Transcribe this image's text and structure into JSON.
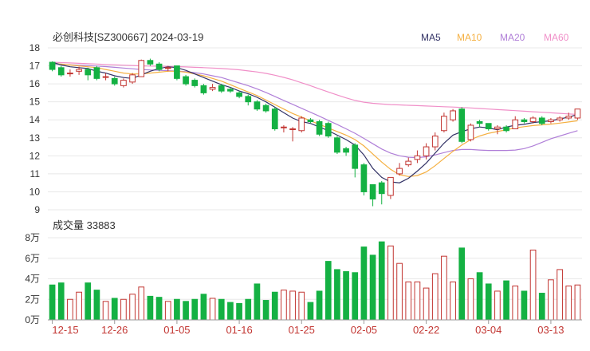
{
  "chart_data": {
    "type": "candlestick",
    "title": "必创科技[SZ300667] 2024-03-19",
    "volume_label": "成交量 33883",
    "colors": {
      "up": "#c23531",
      "down": "#14b143",
      "MA5": "#333366",
      "MA10": "#f5b041",
      "MA20": "#b07fd8",
      "MA60": "#f08fc8"
    },
    "legend": [
      {
        "name": "MA5",
        "color": "#333366"
      },
      {
        "name": "MA10",
        "color": "#f5b041"
      },
      {
        "name": "MA20",
        "color": "#b07fd8"
      },
      {
        "name": "MA60",
        "color": "#f08fc8"
      }
    ],
    "price_axis": {
      "min": 9,
      "max": 18,
      "ticks": [
        "9",
        "10",
        "11",
        "12",
        "13",
        "14",
        "15",
        "16",
        "17",
        "18"
      ]
    },
    "volume_axis": {
      "min": 0,
      "max": 8,
      "ticks": [
        "0万",
        "2万",
        "4万",
        "6万",
        "8万"
      ],
      "tick_values": [
        0,
        2,
        4,
        6,
        8
      ]
    },
    "x_ticks": [
      {
        "label": "12-15",
        "index": 0
      },
      {
        "label": "12-26",
        "index": 7
      },
      {
        "label": "01-05",
        "index": 14
      },
      {
        "label": "01-16",
        "index": 21
      },
      {
        "label": "01-25",
        "index": 28
      },
      {
        "label": "02-05",
        "index": 35
      },
      {
        "label": "02-22",
        "index": 42
      },
      {
        "label": "03-04",
        "index": 49
      },
      {
        "label": "03-13",
        "index": 56
      }
    ],
    "ohlc": [
      [
        17.2,
        16.8,
        17.25,
        16.7
      ],
      [
        16.9,
        16.5,
        17.0,
        16.4
      ],
      [
        16.6,
        16.6,
        16.8,
        16.4
      ],
      [
        16.7,
        16.8,
        16.95,
        16.5
      ],
      [
        16.8,
        16.5,
        16.9,
        16.2
      ],
      [
        16.9,
        16.3,
        17.0,
        16.2
      ],
      [
        16.4,
        16.4,
        16.6,
        16.2
      ],
      [
        16.3,
        16.0,
        16.4,
        15.9
      ],
      [
        15.9,
        16.2,
        16.3,
        15.8
      ],
      [
        16.1,
        16.5,
        16.6,
        16.0
      ],
      [
        16.4,
        17.3,
        17.35,
        16.4
      ],
      [
        17.3,
        17.1,
        17.4,
        17.0
      ],
      [
        17.1,
        16.8,
        17.2,
        16.7
      ],
      [
        16.9,
        16.9,
        17.0,
        16.7
      ],
      [
        17.0,
        16.3,
        17.0,
        16.2
      ],
      [
        16.4,
        16.0,
        16.5,
        15.9
      ],
      [
        16.2,
        15.9,
        16.3,
        15.8
      ],
      [
        15.9,
        15.5,
        16.0,
        15.4
      ],
      [
        15.7,
        15.8,
        16.0,
        15.6
      ],
      [
        15.9,
        15.6,
        16.0,
        15.5
      ],
      [
        15.7,
        15.6,
        15.8,
        15.5
      ],
      [
        15.5,
        15.3,
        15.6,
        15.2
      ],
      [
        15.3,
        15.0,
        15.4,
        14.8
      ],
      [
        15.0,
        14.6,
        15.1,
        14.5
      ],
      [
        14.8,
        14.5,
        14.9,
        14.4
      ],
      [
        14.6,
        13.5,
        14.7,
        13.4
      ],
      [
        13.6,
        13.6,
        13.7,
        13.3
      ],
      [
        13.5,
        13.5,
        13.6,
        12.8
      ],
      [
        13.4,
        14.1,
        14.2,
        13.3
      ],
      [
        14.0,
        13.9,
        14.1,
        13.8
      ],
      [
        13.9,
        13.2,
        14.0,
        13.1
      ],
      [
        13.8,
        13.1,
        13.9,
        13.0
      ],
      [
        13.0,
        12.2,
        13.1,
        12.1
      ],
      [
        12.4,
        12.2,
        12.5,
        12.0
      ],
      [
        12.6,
        11.3,
        12.7,
        10.8
      ],
      [
        11.5,
        10.0,
        11.6,
        9.8
      ],
      [
        10.4,
        9.6,
        10.4,
        9.2
      ],
      [
        10.5,
        9.9,
        10.6,
        9.3
      ],
      [
        9.8,
        10.8,
        10.8,
        9.6
      ],
      [
        11.0,
        11.3,
        11.6,
        10.9
      ],
      [
        11.5,
        11.7,
        11.9,
        11.4
      ],
      [
        11.8,
        12.0,
        12.3,
        11.6
      ],
      [
        12.0,
        12.5,
        12.7,
        11.8
      ],
      [
        12.5,
        13.1,
        13.3,
        12.3
      ],
      [
        13.4,
        14.2,
        14.4,
        13.3
      ],
      [
        14.0,
        14.5,
        14.6,
        13.9
      ],
      [
        14.6,
        12.8,
        14.7,
        12.7
      ],
      [
        12.9,
        13.7,
        13.8,
        12.8
      ],
      [
        13.9,
        13.8,
        14.0,
        13.6
      ],
      [
        13.8,
        13.5,
        13.8,
        13.4
      ],
      [
        13.5,
        13.6,
        13.7,
        13.2
      ],
      [
        13.6,
        13.4,
        13.7,
        13.3
      ],
      [
        13.5,
        14.0,
        14.2,
        13.5
      ],
      [
        14.0,
        13.9,
        14.1,
        13.8
      ],
      [
        13.9,
        14.1,
        14.2,
        13.8
      ],
      [
        14.1,
        13.8,
        14.2,
        13.7
      ],
      [
        13.9,
        14.0,
        14.1,
        13.8
      ],
      [
        14.0,
        14.1,
        14.2,
        13.9
      ],
      [
        14.1,
        14.2,
        14.4,
        14.0
      ],
      [
        14.1,
        14.6,
        14.6,
        14.0
      ]
    ],
    "volume": [
      3.4,
      3.6,
      2.0,
      2.7,
      3.6,
      2.9,
      1.8,
      2.1,
      2.0,
      2.5,
      3.2,
      2.3,
      2.2,
      1.8,
      2.0,
      1.8,
      2.0,
      2.5,
      2.1,
      2.0,
      1.7,
      1.6,
      2.0,
      3.5,
      1.9,
      2.7,
      2.9,
      2.8,
      2.7,
      1.7,
      2.8,
      5.7,
      4.9,
      4.7,
      4.6,
      7.1,
      6.3,
      7.6,
      7.2,
      5.5,
      3.7,
      3.7,
      3.1,
      4.5,
      6.2,
      3.7,
      7.0,
      4.0,
      4.6,
      3.5,
      2.8,
      3.8,
      3.3,
      2.8,
      6.8,
      2.6,
      3.9,
      4.9,
      3.3,
      3.4
    ],
    "ma": {
      "MA5": [
        17.2,
        17.05,
        16.95,
        16.9,
        16.85,
        16.7,
        16.6,
        16.45,
        16.35,
        16.3,
        16.5,
        16.7,
        16.85,
        16.95,
        16.9,
        16.75,
        16.55,
        16.35,
        16.15,
        15.95,
        15.8,
        15.6,
        15.45,
        15.25,
        15.0,
        14.7,
        14.4,
        14.1,
        13.9,
        13.8,
        13.6,
        13.4,
        13.15,
        12.9,
        12.6,
        12.05,
        11.3,
        10.8,
        10.55,
        10.5,
        10.75,
        11.15,
        11.6,
        12.15,
        12.7,
        13.15,
        13.35,
        13.5,
        13.6,
        13.55,
        13.45,
        13.6,
        13.7,
        13.75,
        13.85,
        13.9,
        13.95,
        14.05,
        14.15,
        14.3
      ],
      "MA10": [
        17.15,
        17.1,
        17.05,
        17.0,
        16.95,
        16.9,
        16.8,
        16.7,
        16.6,
        16.55,
        16.55,
        16.6,
        16.65,
        16.7,
        16.7,
        16.65,
        16.55,
        16.45,
        16.3,
        16.15,
        15.95,
        15.75,
        15.55,
        15.35,
        15.1,
        14.85,
        14.6,
        14.35,
        14.15,
        13.95,
        13.75,
        13.55,
        13.35,
        13.15,
        12.9,
        12.55,
        12.1,
        11.65,
        11.25,
        10.95,
        10.85,
        10.9,
        11.1,
        11.45,
        11.85,
        12.25,
        12.6,
        12.9,
        13.1,
        13.25,
        13.35,
        13.45,
        13.55,
        13.62,
        13.68,
        13.72,
        13.76,
        13.82,
        13.88,
        13.95
      ],
      "MA20": [
        17.1,
        17.08,
        17.06,
        17.04,
        17.02,
        16.99,
        16.96,
        16.92,
        16.88,
        16.84,
        16.8,
        16.77,
        16.75,
        16.73,
        16.71,
        16.68,
        16.62,
        16.55,
        16.45,
        16.35,
        16.2,
        16.05,
        15.9,
        15.72,
        15.52,
        15.3,
        15.08,
        14.86,
        14.64,
        14.42,
        14.2,
        13.97,
        13.74,
        13.5,
        13.25,
        12.97,
        12.67,
        12.38,
        12.15,
        12.0,
        11.92,
        11.9,
        11.95,
        12.05,
        12.18,
        12.3,
        12.35,
        12.35,
        12.32,
        12.3,
        12.3,
        12.3,
        12.32,
        12.4,
        12.55,
        12.75,
        12.95,
        13.1,
        13.25,
        13.4
      ],
      "MA60": [
        17.2,
        17.18,
        17.16,
        17.14,
        17.12,
        17.1,
        17.08,
        17.06,
        17.04,
        17.02,
        17.0,
        16.99,
        16.98,
        16.97,
        16.96,
        16.94,
        16.92,
        16.9,
        16.88,
        16.85,
        16.82,
        16.78,
        16.72,
        16.66,
        16.58,
        16.48,
        16.36,
        16.22,
        16.06,
        15.9,
        15.72,
        15.55,
        15.38,
        15.22,
        15.08,
        14.98,
        14.92,
        14.88,
        14.85,
        14.83,
        14.81,
        14.79,
        14.77,
        14.75,
        14.73,
        14.71,
        14.69,
        14.66,
        14.63,
        14.6,
        14.57,
        14.54,
        14.51,
        14.48,
        14.45,
        14.42,
        14.39,
        14.36,
        14.33,
        14.3
      ]
    }
  }
}
